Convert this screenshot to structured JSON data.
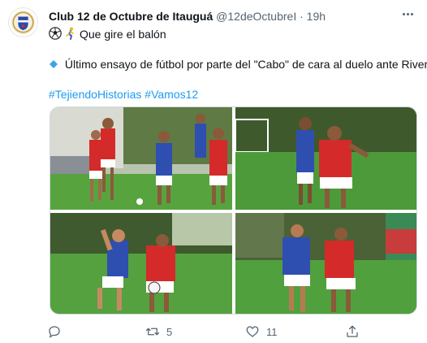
{
  "tweet": {
    "author_name": "Club 12 de Octubre de Itauguá",
    "handle": "@12deOctubreI",
    "separator": "·",
    "time": "19h",
    "line1": "Que gire el balón",
    "line2": "Último ensayo de fútbol por parte del \"Cabo\" de cara al duelo ante River",
    "hashtags": [
      "#TejiendoHistorias",
      "#Vamos12"
    ]
  },
  "actions": {
    "replies": "",
    "retweets": "5",
    "likes": "11"
  },
  "icons": [
    "club-crest-icon",
    "soccer-ball-icon",
    "runner-icon",
    "diamond-icon",
    "more-icon",
    "reply-icon",
    "retweet-icon",
    "like-icon",
    "share-icon"
  ],
  "colors": {
    "link": "#1d9bf0",
    "muted": "#536471",
    "text": "#0f1419",
    "jersey_red": "#d42a2a",
    "jersey_blue": "#2f4fb0",
    "pitch": "#4c9a3a"
  }
}
